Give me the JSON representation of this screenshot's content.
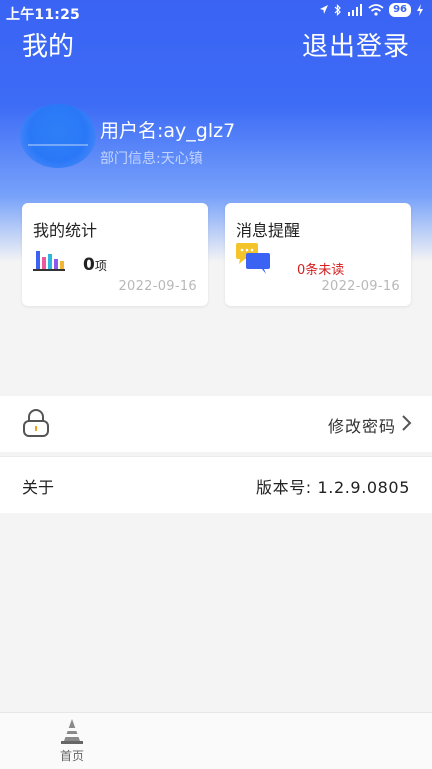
{
  "status_bar": {
    "time": "上午11:25",
    "battery": "96"
  },
  "header": {
    "title": "我的",
    "logout_label": "退出登录"
  },
  "profile": {
    "username": "用户名:ay_glz7",
    "department": "部门信息:天心镇"
  },
  "stats_card": {
    "title": "我的统计",
    "count": "0",
    "unit": "项",
    "date": "2022-09-16"
  },
  "message_card": {
    "title": "消息提醒",
    "unread_count": "0",
    "unread_text": "条未读",
    "date": "2022-09-16"
  },
  "password_row": {
    "label": "修改密码"
  },
  "about_row": {
    "label": "关于",
    "version": "版本号: 1.2.9.0805"
  },
  "tab_bar": {
    "items": [
      {
        "label": "首页"
      }
    ]
  },
  "colors": {
    "primary": "#3a63f4",
    "unread": "#d42020"
  }
}
